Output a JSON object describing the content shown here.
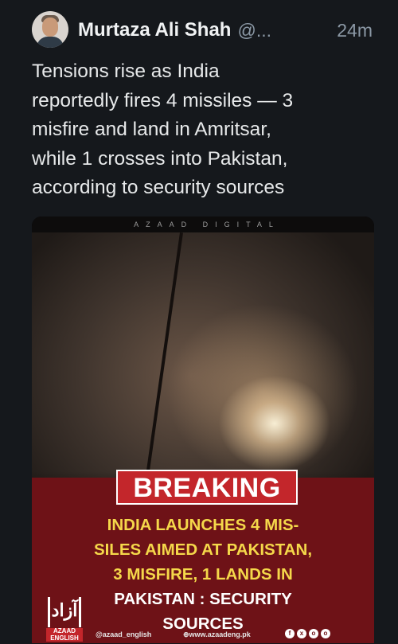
{
  "tweet": {
    "author": "Murtaza Ali Shah",
    "handle": "@...",
    "time": "24m",
    "text_lines": [
      "Tensions rise as India",
      "reportedly fires 4 missiles — 3",
      "misfire and land in Amritsar,",
      "while 1 crosses into Pakistan,",
      "according to security sources"
    ]
  },
  "media": {
    "watermark": "AZAAD DIGITAL",
    "breaking_label": "BREAKING",
    "headline_lines": [
      "INDIA LAUNCHES 4 MIS-",
      "SILES AIMED AT PAKISTAN,",
      "3 MISFIRE, 1 LANDS IN",
      "PAKISTAN : SECURITY",
      "SOURCES"
    ],
    "logo_mark": "آزاد",
    "logo_text": "AZAAD ENGLISH",
    "footer_handle": "@azaad_english",
    "footer_site": "⊕www.azaadeng.pk",
    "social_icons": [
      "f",
      "x",
      "o",
      "o"
    ]
  },
  "colors": {
    "background": "#15181c",
    "breaking_red": "#c3262b",
    "panel_maroon": "#6e1217",
    "headline_yellow": "#f5d84a"
  }
}
